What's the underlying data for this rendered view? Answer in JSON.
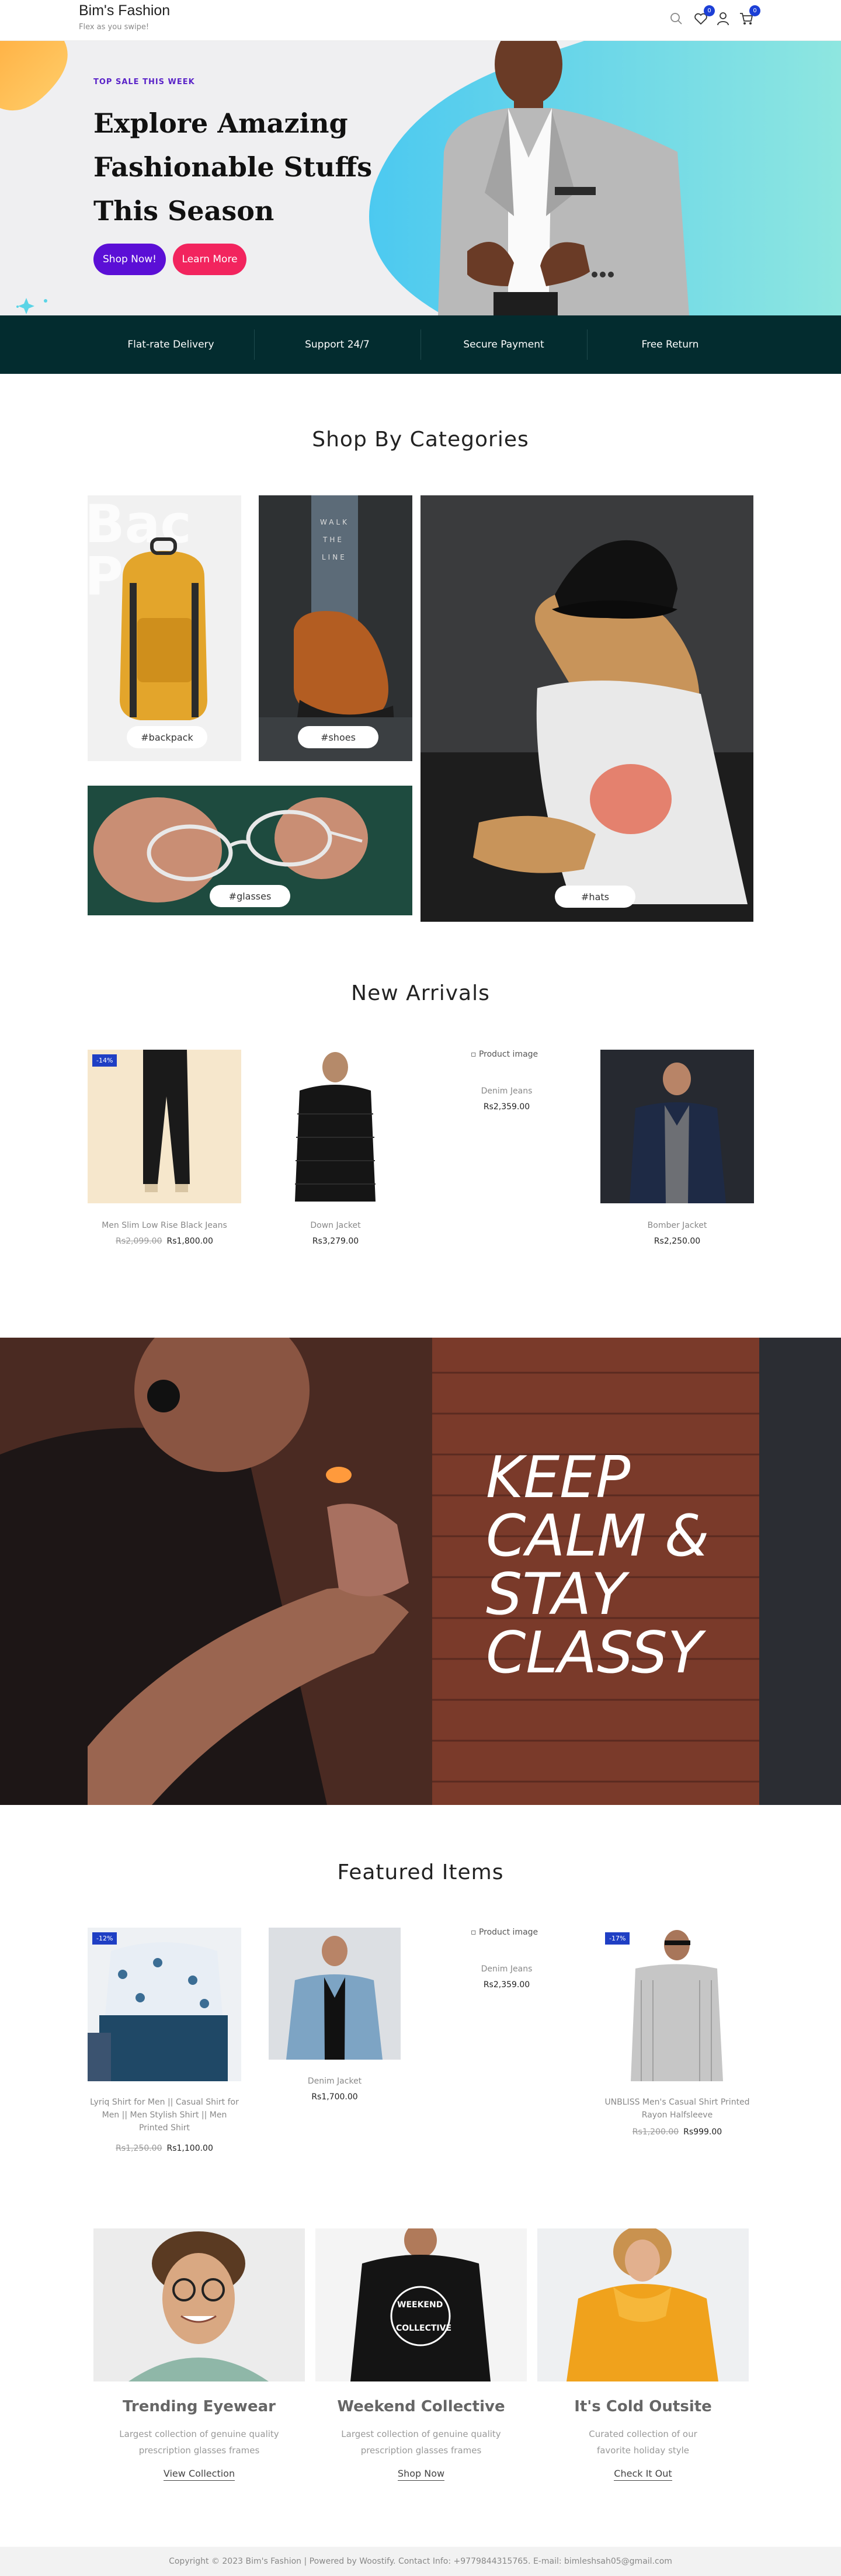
{
  "header": {
    "brand": "Bim's Fashion",
    "tagline": "Flex as you swipe!",
    "wishlist_count": "0",
    "cart_count": "0",
    "icons": [
      "search-icon",
      "heart-icon",
      "user-icon",
      "cart-icon"
    ]
  },
  "hero": {
    "eyebrow": "TOP SALE THIS WEEK",
    "title": "Explore Amazing Fashionable Stuffs This Season",
    "shop_now": "Shop Now!",
    "learn_more": "Learn More",
    "colors": {
      "shop_now": "#5b0fd6",
      "learn_more": "#f2245e",
      "blob": "#5ed8ec"
    }
  },
  "features": [
    "Flat-rate Delivery",
    "Support 24/7",
    "Secure Payment",
    "Free Return"
  ],
  "categories": {
    "title": "Shop By Categories",
    "items": [
      {
        "tag": "#backpack"
      },
      {
        "tag": "#shoes"
      },
      {
        "tag": "#glasses"
      },
      {
        "tag": "#hats"
      }
    ]
  },
  "new_arrivals": {
    "title": "New Arrivals",
    "products": [
      {
        "name": "Men Slim Low Rise Black Jeans",
        "old_price": "Rs2,099.00",
        "price": "Rs1,800.00",
        "badge": "-14%"
      },
      {
        "name": "Down Jacket",
        "old_price": "",
        "price": "Rs3,279.00",
        "badge": ""
      },
      {
        "name": "Denim Jeans",
        "old_price": "",
        "price": "Rs2,359.00",
        "badge": "",
        "alt": "Product image"
      },
      {
        "name": "Bomber Jacket",
        "old_price": "",
        "price": "Rs2,250.00",
        "badge": ""
      }
    ]
  },
  "banner": {
    "text_lines": [
      "KEEP",
      "CALM &",
      "STAY",
      "CLASSY"
    ]
  },
  "featured": {
    "title": "Featured Items",
    "products": [
      {
        "name": "Lyriq Shirt for Men || Casual Shirt for Men || Men Stylish Shirt || Men Printed Shirt",
        "old_price": "Rs1,250.00",
        "price": "Rs1,100.00",
        "badge": "-12%"
      },
      {
        "name": "Denim Jacket",
        "old_price": "",
        "price": "Rs1,700.00",
        "badge": ""
      },
      {
        "name": "Denim Jeans",
        "old_price": "",
        "price": "Rs2,359.00",
        "badge": "",
        "alt": "Product image"
      },
      {
        "name": "UNBLISS Men's Casual Shirt Printed Rayon Halfsleeve",
        "old_price": "Rs1,200.00",
        "price": "Rs999.00",
        "badge": "-17%"
      }
    ]
  },
  "collections": [
    {
      "title": "Trending Eyewear",
      "desc": "Largest collection of genuine quality prescription glasses frames",
      "link": "View Collection"
    },
    {
      "title": "Weekend Collective",
      "desc": "Largest collection of genuine quality prescription glasses frames",
      "link": "Shop Now"
    },
    {
      "title": "It's Cold Outsite",
      "desc": "Curated collection of our favorite holiday style",
      "link": "Check It Out"
    }
  ],
  "footer": {
    "text": "Copyright © 2023 Bim's Fashion | Powered by Woostify. Contact Info: +9779844315765. E-mail: bimleshsah05@gmail.com"
  }
}
